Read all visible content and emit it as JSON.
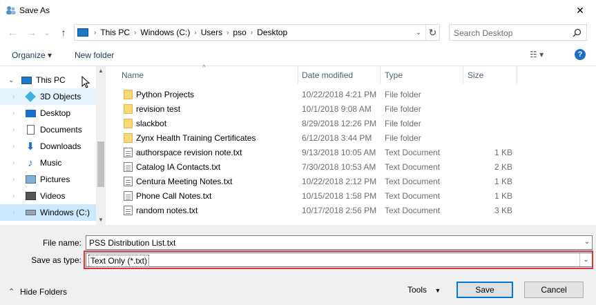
{
  "window": {
    "title": "Save As",
    "close_glyph": "✕"
  },
  "nav": {
    "back_glyph": "←",
    "forward_glyph": "→",
    "recent_glyph": "⌄",
    "up_glyph": "↑",
    "breadcrumbs": [
      "This PC",
      "Windows (C:)",
      "Users",
      "pso",
      "Desktop"
    ],
    "refresh_glyph": "↻",
    "search_placeholder": "Search Desktop"
  },
  "toolbar": {
    "organize_label": "Organize ▾",
    "new_folder_label": "New folder",
    "view_glyph": "☷ ▾",
    "help_glyph": "?"
  },
  "sidebar": {
    "items": [
      {
        "label": "This PC",
        "icon": "computer-icon",
        "state": "normal"
      },
      {
        "label": "3D Objects",
        "icon": "cube-icon",
        "state": "hover"
      },
      {
        "label": "Desktop",
        "icon": "desktop-icon",
        "state": "normal"
      },
      {
        "label": "Documents",
        "icon": "documents-icon",
        "state": "normal"
      },
      {
        "label": "Downloads",
        "icon": "download-icon",
        "state": "normal"
      },
      {
        "label": "Music",
        "icon": "music-icon",
        "state": "normal"
      },
      {
        "label": "Pictures",
        "icon": "pictures-icon",
        "state": "normal"
      },
      {
        "label": "Videos",
        "icon": "videos-icon",
        "state": "normal"
      },
      {
        "label": "Windows (C:)",
        "icon": "drive-icon",
        "state": "selected"
      }
    ]
  },
  "filelist": {
    "columns": [
      "Name",
      "Date modified",
      "Type",
      "Size"
    ],
    "rows": [
      {
        "name": "Python Projects",
        "date": "10/22/2018 4:21 PM",
        "type": "File folder",
        "size": "",
        "kind": "folder"
      },
      {
        "name": "revision test",
        "date": "10/1/2018 9:08 AM",
        "type": "File folder",
        "size": "",
        "kind": "folder"
      },
      {
        "name": "slackbot",
        "date": "8/29/2018 12:26 PM",
        "type": "File folder",
        "size": "",
        "kind": "folder"
      },
      {
        "name": "Zynx Health Training Certificates",
        "date": "6/12/2018 3:44 PM",
        "type": "File folder",
        "size": "",
        "kind": "folder"
      },
      {
        "name": "authorspace revision note.txt",
        "date": "9/13/2018 10:05 AM",
        "type": "Text Document",
        "size": "1 KB",
        "kind": "doc"
      },
      {
        "name": "Catalog IA Contacts.txt",
        "date": "7/30/2018 10:53 AM",
        "type": "Text Document",
        "size": "2 KB",
        "kind": "doc"
      },
      {
        "name": "Centura Meeting Notes.txt",
        "date": "10/22/2018 2:12 PM",
        "type": "Text Document",
        "size": "1 KB",
        "kind": "doc"
      },
      {
        "name": "Phone Call Notes.txt",
        "date": "10/15/2018 1:58 PM",
        "type": "Text Document",
        "size": "1 KB",
        "kind": "doc"
      },
      {
        "name": "random notes.txt",
        "date": "10/17/2018 2:56 PM",
        "type": "Text Document",
        "size": "3 KB",
        "kind": "doc"
      }
    ]
  },
  "form": {
    "filename_label": "File name:",
    "filename_value": "PSS Distribution List.txt",
    "savetype_label": "Save as type:",
    "savetype_value": "Text Only (*.txt)"
  },
  "footer": {
    "hide_folders_label": "Hide Folders",
    "tools_label": "Tools",
    "save_label": "Save",
    "cancel_label": "Cancel"
  },
  "colors": {
    "highlight_border": "#e0323c",
    "selected_bg": "#cce8ff",
    "accent": "#0078d7"
  }
}
